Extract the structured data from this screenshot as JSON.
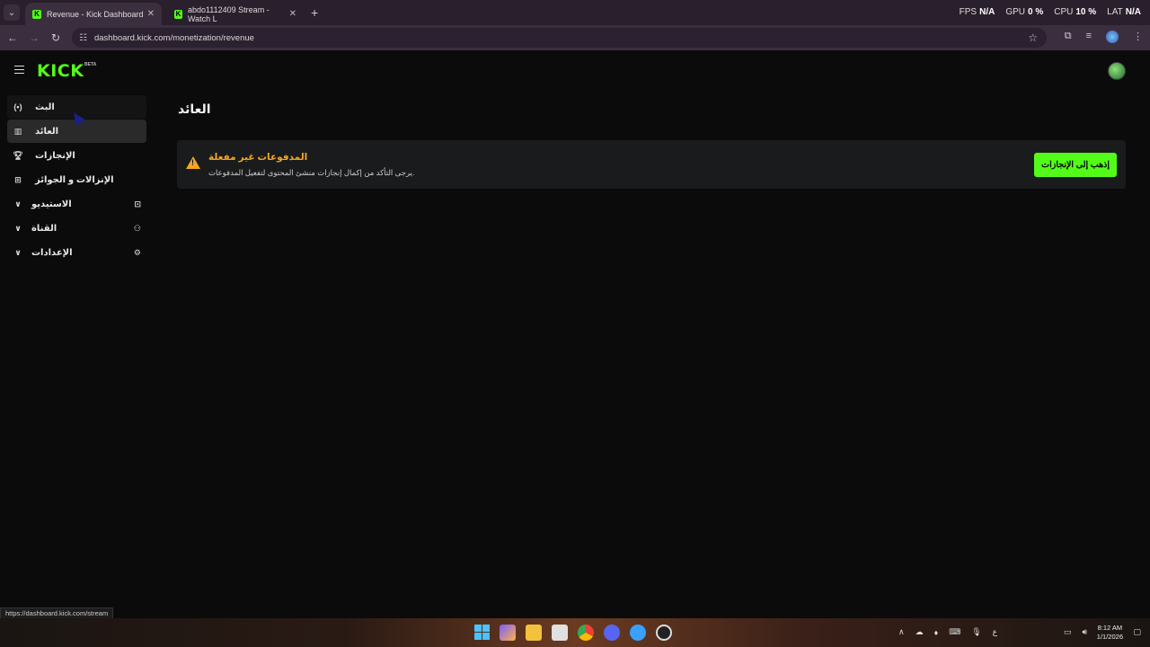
{
  "browser": {
    "tabs": [
      {
        "title": "Revenue - Kick Dashboard",
        "favicon": "K",
        "active": true
      },
      {
        "title": "abdo1112409 Stream - Watch L",
        "favicon": "K",
        "active": false
      }
    ],
    "perf": {
      "fps_label": "FPS",
      "fps_value": "N/A",
      "gpu_label": "GPU",
      "gpu_value": "0 %",
      "cpu_label": "CPU",
      "cpu_value": "10 %",
      "lat_label": "LAT",
      "lat_value": "N/A"
    },
    "url": "dashboard.kick.com/monetization/revenue"
  },
  "header": {
    "logo": "KICK",
    "logo_badge": "BETA"
  },
  "sidebar": {
    "items": [
      {
        "label": "البث",
        "icon": "broadcast-icon"
      },
      {
        "label": "العائد",
        "icon": "chart-icon"
      },
      {
        "label": "الإنجازات",
        "icon": "trophy-icon"
      },
      {
        "label": "الإنزالات و الجوائز",
        "icon": "gift-icon"
      },
      {
        "label": "الاستيديو",
        "icon": "studio-icon"
      },
      {
        "label": "القناة",
        "icon": "channel-icon"
      },
      {
        "label": "الإعدادات",
        "icon": "gear-icon"
      }
    ]
  },
  "main": {
    "title": "العائد",
    "notice": {
      "title": "المدفوعات غير مفعلة",
      "description": "يرجى التأكد من إكمال إنجازات منشئ المحتوى لتفعيل المدفوعات.",
      "button": "إذهب إلى الإنجازات"
    }
  },
  "status_url": "https://dashboard.kick.com/stream",
  "taskbar": {
    "time": "8:12 AM",
    "date": "1/1/2026",
    "lang": "ع"
  },
  "colors": {
    "accent": "#53fc18",
    "warning": "#f5a623",
    "background": "#0b0b0b"
  }
}
